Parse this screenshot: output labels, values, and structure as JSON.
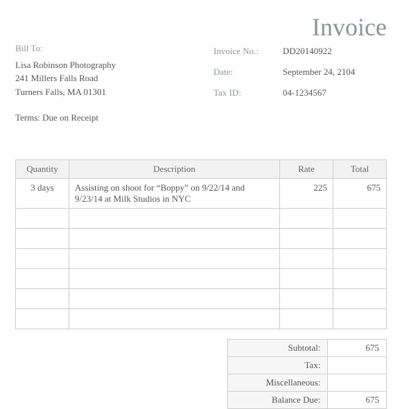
{
  "title": "Invoice",
  "bill_to_label": "Bill To:",
  "bill_to": {
    "name": "Lisa Robinson Photography",
    "street": "241 Millers Falls Road",
    "city_state_zip": "Turners Falls, MA  01301"
  },
  "terms": "Terms:  Due on Receipt",
  "meta": {
    "invoice_no_label": "Invoice No.:",
    "invoice_no": "DD20140922",
    "date_label": "Date:",
    "date": "September 24, 2104",
    "tax_id_label": "Tax ID:",
    "tax_id": "04-1234567"
  },
  "columns": {
    "quantity": "Quantity",
    "description": "Description",
    "rate": "Rate",
    "total": "Total"
  },
  "rows": [
    {
      "quantity": "3 days",
      "description": "Assisting on shoot for “Boppy” on 9/22/14 and 9/23/14 at Milk Studios in NYC",
      "rate": "225",
      "total": "675"
    },
    {
      "quantity": "",
      "description": "",
      "rate": "",
      "total": ""
    },
    {
      "quantity": "",
      "description": "",
      "rate": "",
      "total": ""
    },
    {
      "quantity": "",
      "description": "",
      "rate": "",
      "total": ""
    },
    {
      "quantity": "",
      "description": "",
      "rate": "",
      "total": ""
    },
    {
      "quantity": "",
      "description": "",
      "rate": "",
      "total": ""
    },
    {
      "quantity": "",
      "description": "",
      "rate": "",
      "total": ""
    }
  ],
  "totals": {
    "subtotal_label": "Subtotal:",
    "subtotal": "675",
    "tax_label": "Tax:",
    "tax": "",
    "misc_label": "Miscellaneous:",
    "misc": "",
    "balance_label": "Balance Due:",
    "balance": "675"
  }
}
